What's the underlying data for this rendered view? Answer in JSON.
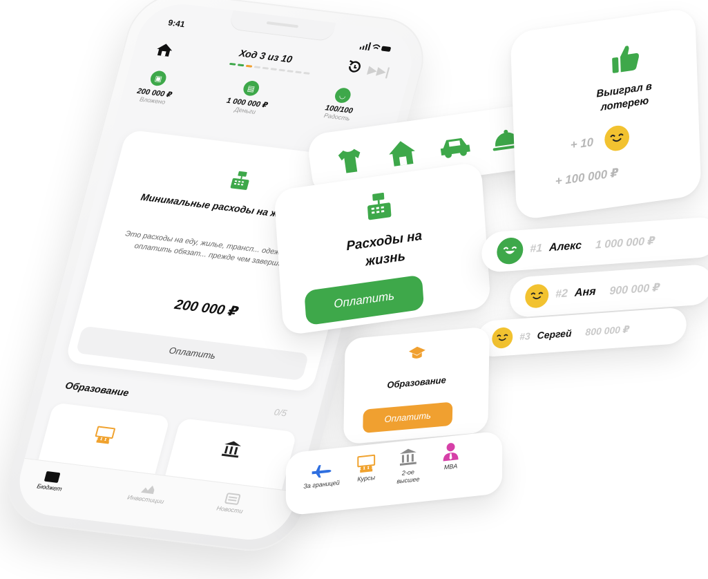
{
  "phone": {
    "status_time": "9:41",
    "status_icons": "∙∙∙ ≡",
    "turn_title": "Ход 3 из 10",
    "progress": {
      "current": 3,
      "total": 10
    },
    "stats": [
      {
        "value": "200 000 ₽",
        "label": "Вложено",
        "icon": "briefcase-icon"
      },
      {
        "value": "1 000 000 ₽",
        "label": "Деньги",
        "icon": "wallet-icon"
      },
      {
        "value": "100/100",
        "label": "Радость",
        "icon": "smile-icon"
      }
    ],
    "main_card": {
      "title": "Минимальные расходы на жизнь за год",
      "description": "Это расходы на еду, жилье, трансп... одежду. Их нужно оплатить обязат... прежде чем завершить ход.",
      "amount": "200 000 ₽",
      "pay_label": "Оплатить"
    },
    "education": {
      "title": "Образование",
      "count": "0/5"
    },
    "tabs": [
      {
        "label": "Бюджет",
        "icon": "wallet-icon"
      },
      {
        "label": "Инвестиции",
        "icon": "chart-icon"
      },
      {
        "label": "Новости",
        "icon": "news-icon"
      }
    ]
  },
  "lottery": {
    "title": "Выиграл в лотерею",
    "joy": "+ 10",
    "money": "+ 100 000 ₽"
  },
  "expenses": {
    "title": "Расходы на жизнь",
    "pay_label": "Оплатить"
  },
  "leaderboard": [
    {
      "pos": "#1",
      "name": "Алекс",
      "money": "1 000 000 ₽",
      "color": "#3ea84a"
    },
    {
      "pos": "#2",
      "name": "Аня",
      "money": "900 000 ₽",
      "color": "#f2c230"
    },
    {
      "pos": "#3",
      "name": "Сергей",
      "money": "800 000 ₽",
      "color": "#f2c230"
    }
  ],
  "education_card": {
    "title": "Образование",
    "pay_label": "Оплатить"
  },
  "edu_options": [
    {
      "label": "За границей",
      "icon": "plane-icon",
      "color": "#2f6fe0"
    },
    {
      "label": "Курсы",
      "icon": "courses-icon",
      "color": "#f0a22e"
    },
    {
      "label": "2-ое высшее",
      "icon": "university-icon",
      "color": "#8a8a8a"
    },
    {
      "label": "MBA",
      "icon": "person-tie-icon",
      "color": "#d640a8"
    }
  ],
  "colors": {
    "green": "#3ea84a",
    "orange": "#f0a030",
    "yellow": "#f2c230"
  }
}
